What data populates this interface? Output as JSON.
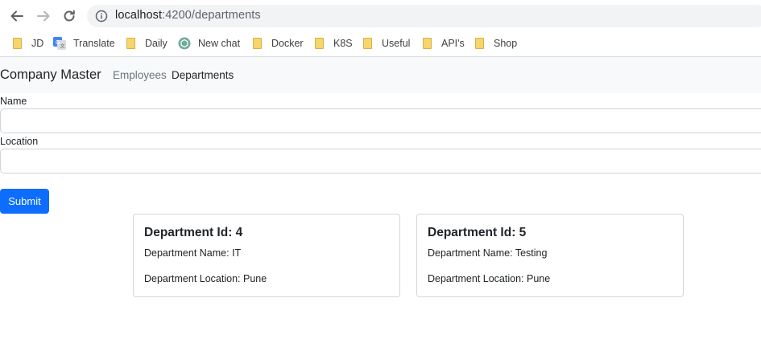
{
  "browser": {
    "url_host": "localhost",
    "url_path": ":4200/departments",
    "bookmarks": [
      {
        "label": "JD",
        "icon": "folder-icon"
      },
      {
        "label": "Translate",
        "icon": "google-translate-icon"
      },
      {
        "label": "Daily",
        "icon": "folder-icon"
      },
      {
        "label": "New chat",
        "icon": "chatgpt-icon"
      },
      {
        "label": "Docker",
        "icon": "folder-icon"
      },
      {
        "label": "K8S",
        "icon": "folder-icon"
      },
      {
        "label": "Useful",
        "icon": "folder-icon"
      },
      {
        "label": "API's",
        "icon": "folder-icon"
      },
      {
        "label": "Shop",
        "icon": "folder-icon"
      }
    ]
  },
  "navbar": {
    "brand": "Company Master",
    "links": [
      {
        "label": "Employees",
        "active": false
      },
      {
        "label": "Departments",
        "active": true
      }
    ]
  },
  "form": {
    "name_label": "Name",
    "name_value": "",
    "location_label": "Location",
    "location_value": "",
    "submit_label": "Submit"
  },
  "departments": [
    {
      "title": "Department Id: 4",
      "name_line": "Department Name: IT",
      "location_line": "Department Location: Pune"
    },
    {
      "title": "Department Id: 5",
      "name_line": "Department Name: Testing",
      "location_line": "Department Location: Pune"
    }
  ],
  "colors": {
    "primary": "#0d6efd",
    "navbar_bg": "#f8f9fa",
    "muted_text": "#6c757d"
  }
}
